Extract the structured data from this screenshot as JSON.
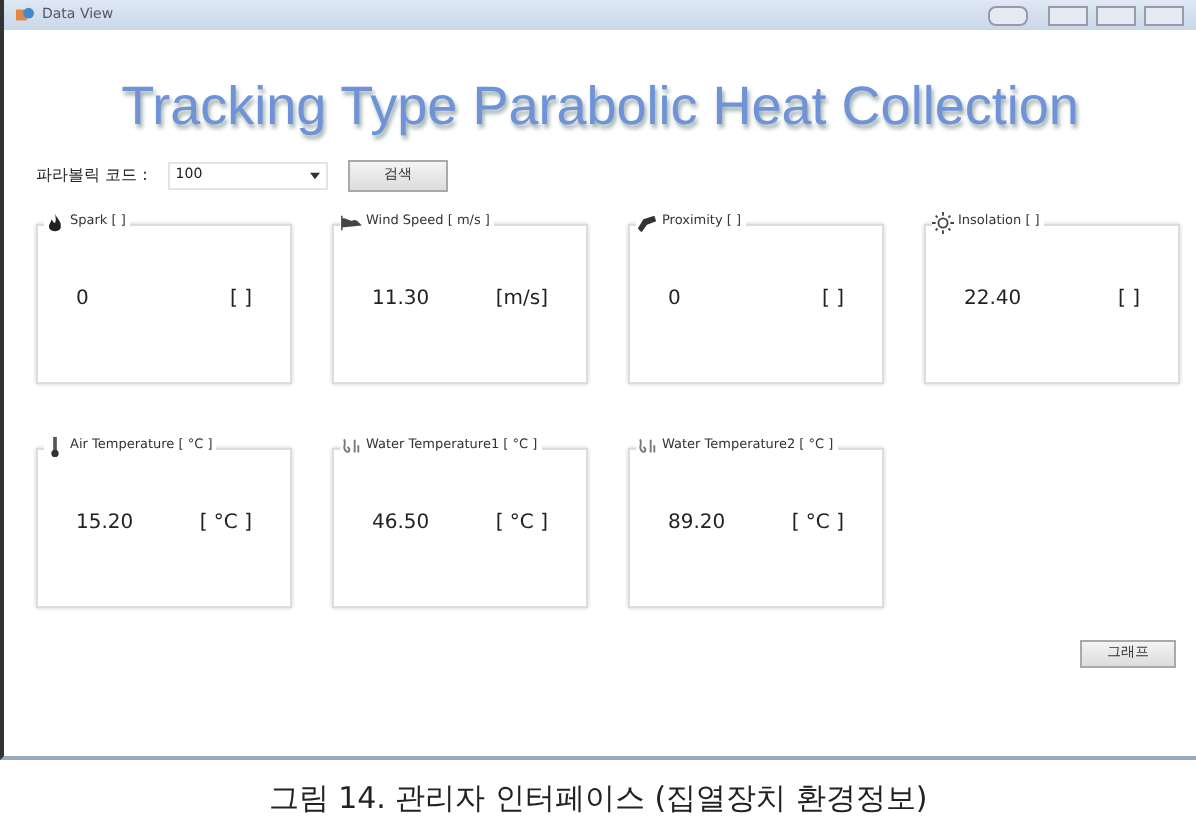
{
  "window": {
    "title": "Data View"
  },
  "heading": "Tracking Type Parabolic Heat Collection",
  "search": {
    "label": "파라볼릭 코드 :",
    "value": "100",
    "button": "검색"
  },
  "sensors": [
    {
      "kind": "flame",
      "title": "Spark [ ]",
      "value": "0",
      "unit": "[ ]"
    },
    {
      "kind": "wind",
      "title": "Wind Speed [ m/s ]",
      "value": "11.30",
      "unit": "[m/s]"
    },
    {
      "kind": "proximity",
      "title": "Proximity [ ]",
      "value": "0",
      "unit": "[ ]"
    },
    {
      "kind": "sun",
      "title": "Insolation [ ]",
      "value": "22.40",
      "unit": "[ ]"
    },
    {
      "kind": "thermometer",
      "title": "Air Temperature [ °C ]",
      "value": "15.20",
      "unit": "[ °C ]"
    },
    {
      "kind": "water",
      "title": "Water Temperature1 [ °C ]",
      "value": "46.50",
      "unit": "[ °C ]"
    },
    {
      "kind": "water",
      "title": "Water Temperature2 [ °C ]",
      "value": "89.20",
      "unit": "[ °C ]"
    }
  ],
  "graph_button": "그래프",
  "caption": "그림 14. 관리자 인터페이스 (집열장치 환경정보)"
}
